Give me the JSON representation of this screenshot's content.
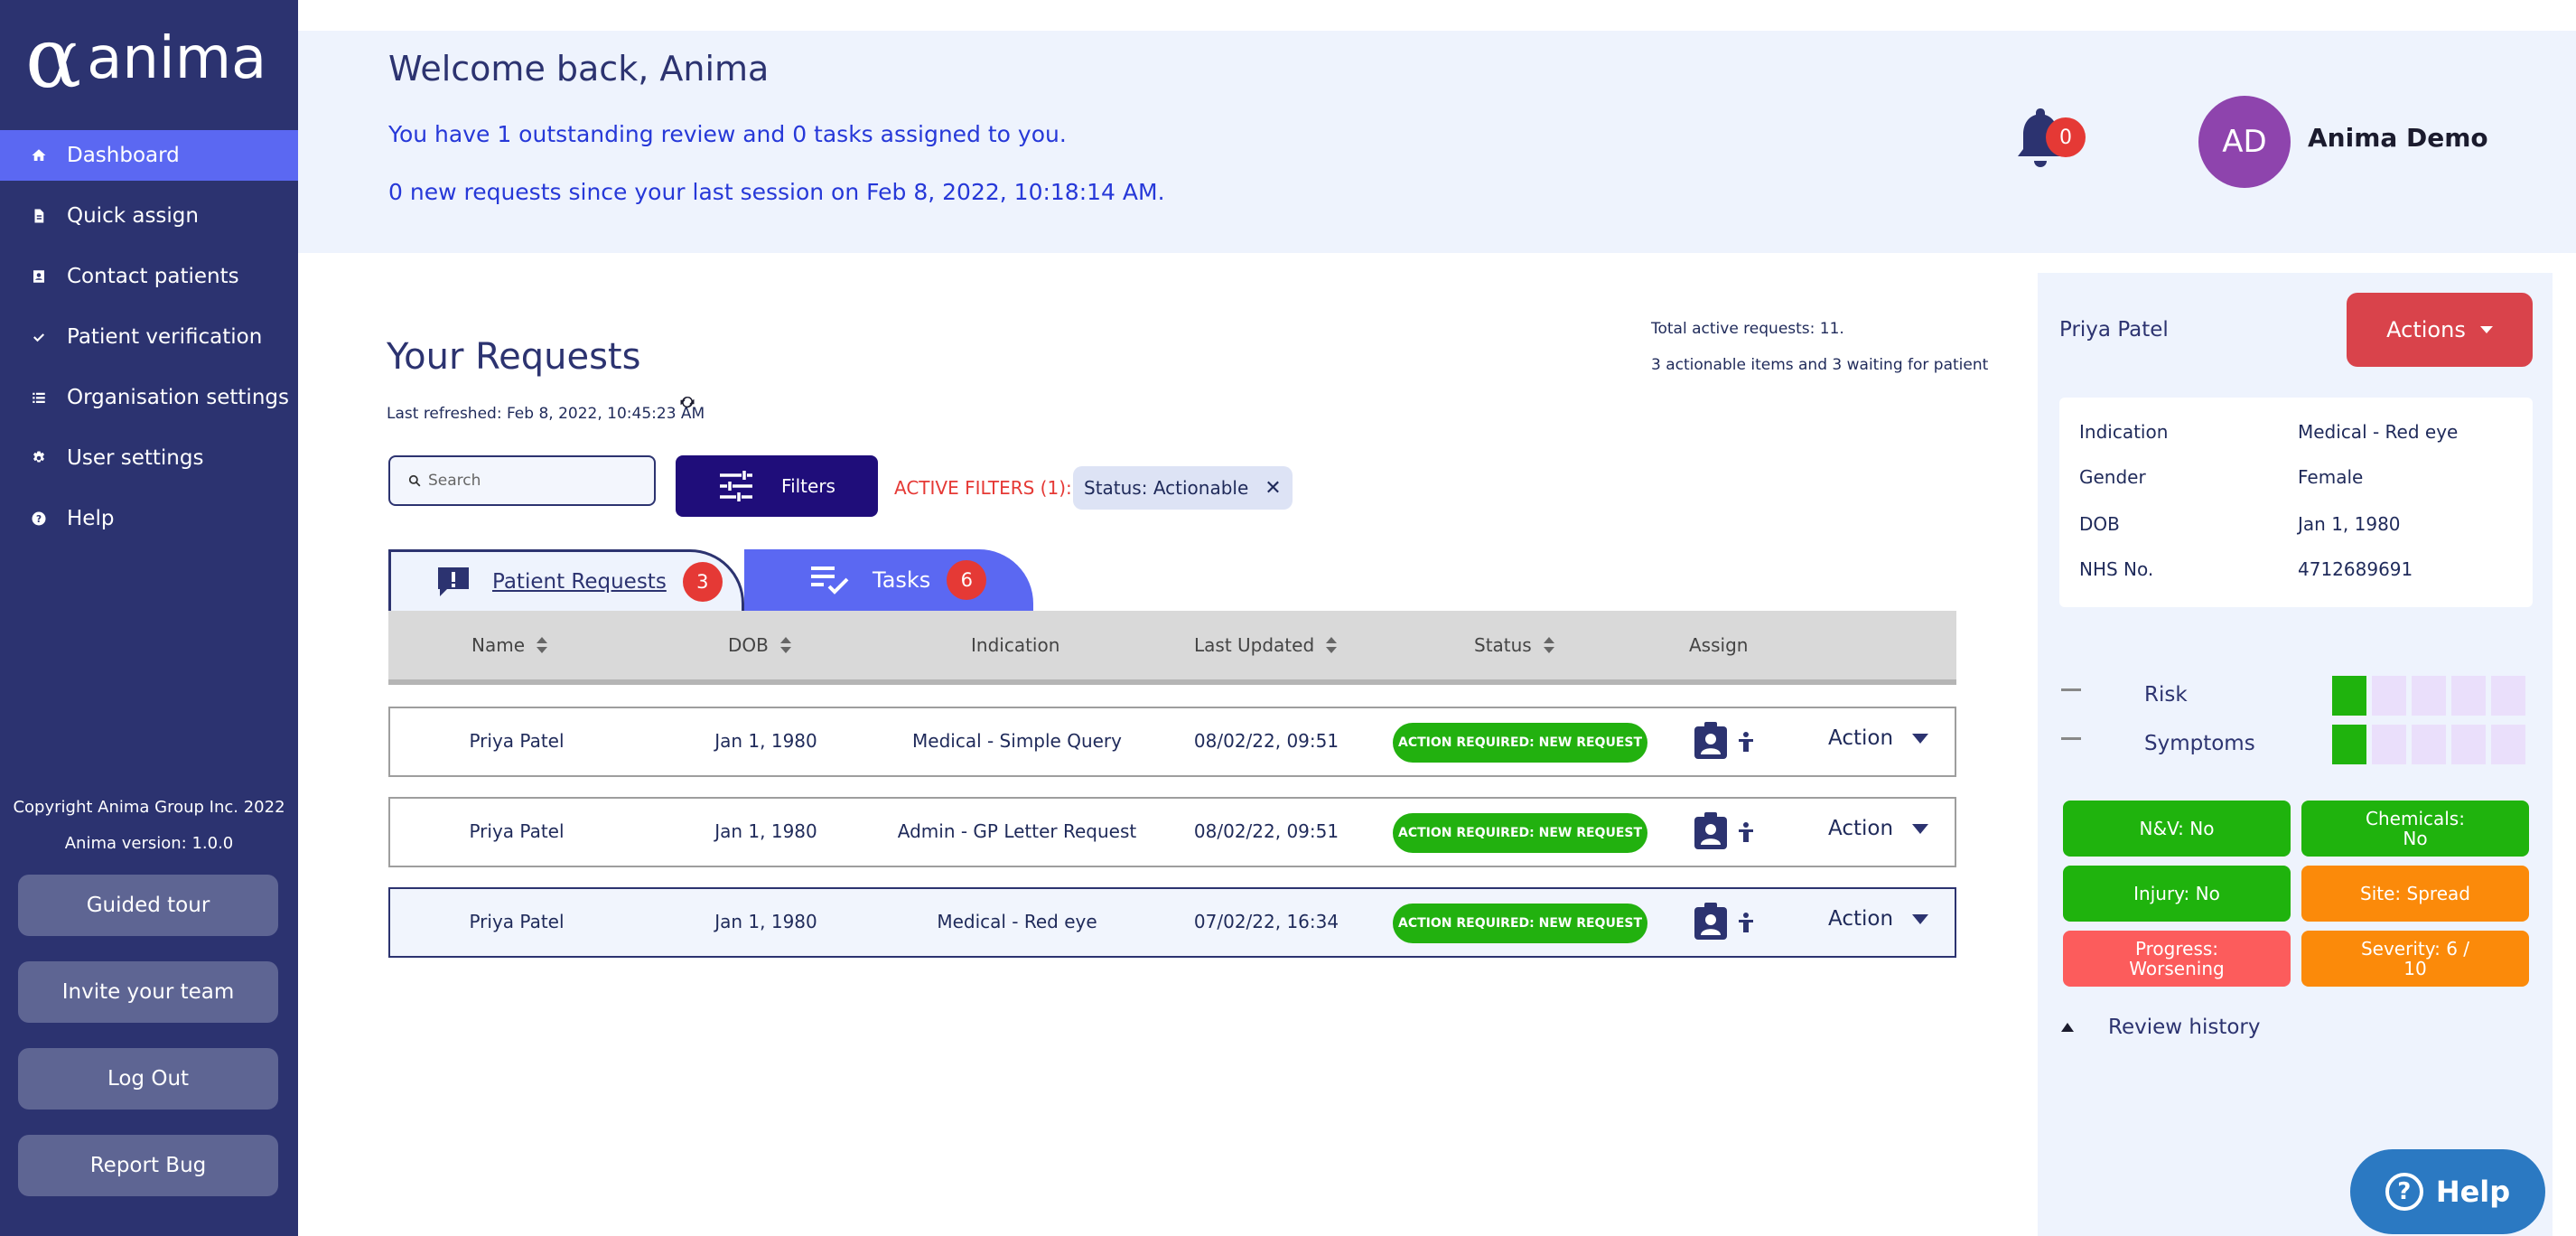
{
  "brand": {
    "mark": "α",
    "name": "anima"
  },
  "sidebar": {
    "items": [
      {
        "label": "Dashboard",
        "icon": "home-icon",
        "active": true
      },
      {
        "label": "Quick assign",
        "icon": "document-icon"
      },
      {
        "label": "Contact patients",
        "icon": "contact-card-icon"
      },
      {
        "label": "Patient verification",
        "icon": "check-icon"
      },
      {
        "label": "Organisation settings",
        "icon": "list-icon"
      },
      {
        "label": "User settings",
        "icon": "gear-icon"
      },
      {
        "label": "Help",
        "icon": "question-circle-icon"
      }
    ],
    "copyright": "Copyright Anima Group Inc. 2022",
    "version": "Anima version: 1.0.0",
    "buttons": {
      "guided_tour": "Guided tour",
      "invite_team": "Invite your team",
      "log_out": "Log Out",
      "report_bug": "Report Bug"
    }
  },
  "header": {
    "welcome": "Welcome back, Anima",
    "line1": "You have 1 outstanding review and 0 tasks assigned to you.",
    "line2": "0 new requests since your last session on Feb 8, 2022, 10:18:14 AM.",
    "notifications": "0",
    "avatar_initials": "AD",
    "user_name": "Anima Demo"
  },
  "requests": {
    "title": "Your Requests",
    "last_refreshed": "Last refreshed: Feb 8, 2022, 10:45:23 AM",
    "total_active": "Total active requests: 11.",
    "actionable_summary": "3 actionable items and 3 waiting for patient",
    "search_placeholder": "Search",
    "filters_label": "Filters",
    "active_filters_label": "ACTIVE FILTERS (1):",
    "filter_chip": "Status: Actionable",
    "tabs": [
      {
        "label": "Patient Requests",
        "count": "3"
      },
      {
        "label": "Tasks",
        "count": "6"
      }
    ],
    "columns": [
      "Name",
      "DOB",
      "Indication",
      "Last Updated",
      "Status",
      "Assign"
    ],
    "rows": [
      {
        "name": "Priya Patel",
        "dob": "Jan 1, 1980",
        "indication": "Medical - Simple Query",
        "updated": "08/02/22, 09:51",
        "status": "ACTION REQUIRED: NEW REQUEST",
        "action": "Action"
      },
      {
        "name": "Priya Patel",
        "dob": "Jan 1, 1980",
        "indication": "Admin - GP Letter Request",
        "updated": "08/02/22, 09:51",
        "status": "ACTION REQUIRED: NEW REQUEST",
        "action": "Action"
      },
      {
        "name": "Priya Patel",
        "dob": "Jan 1, 1980",
        "indication": "Medical - Red eye",
        "updated": "07/02/22, 16:34",
        "status": "ACTION REQUIRED: NEW REQUEST",
        "action": "Action"
      }
    ]
  },
  "panel": {
    "patient_name": "Priya Patel",
    "actions_label": "Actions",
    "info": [
      {
        "label": "Indication",
        "value": "Medical - Red eye"
      },
      {
        "label": "Gender",
        "value": "Female"
      },
      {
        "label": "DOB",
        "value": "Jan 1, 1980"
      },
      {
        "label": "NHS No.",
        "value": "4712689691"
      }
    ],
    "scores": [
      {
        "label": "Risk",
        "level": 1,
        "max": 5
      },
      {
        "label": "Symptoms",
        "level": 1,
        "max": 5
      }
    ],
    "chips": [
      {
        "label": "N&V: No",
        "color": "#1fb30d"
      },
      {
        "label": "Chemicals:\nNo",
        "color": "#1fb30d"
      },
      {
        "label": "Injury: No",
        "color": "#1fb30d"
      },
      {
        "label": "Site: Spread",
        "color": "#fb8a0a"
      },
      {
        "label": "Progress:\nWorsening",
        "color": "#fc5c5c"
      },
      {
        "label": "Severity: 6 /\n10",
        "color": "#fb8a0a"
      }
    ],
    "review_history": "Review history"
  },
  "help_button": "Help",
  "colors": {
    "sidebar": "#2c3370",
    "accent": "#5b68f2",
    "status_green": "#22b10f",
    "danger": "#e53935",
    "filters_button": "#1f0d7a"
  }
}
